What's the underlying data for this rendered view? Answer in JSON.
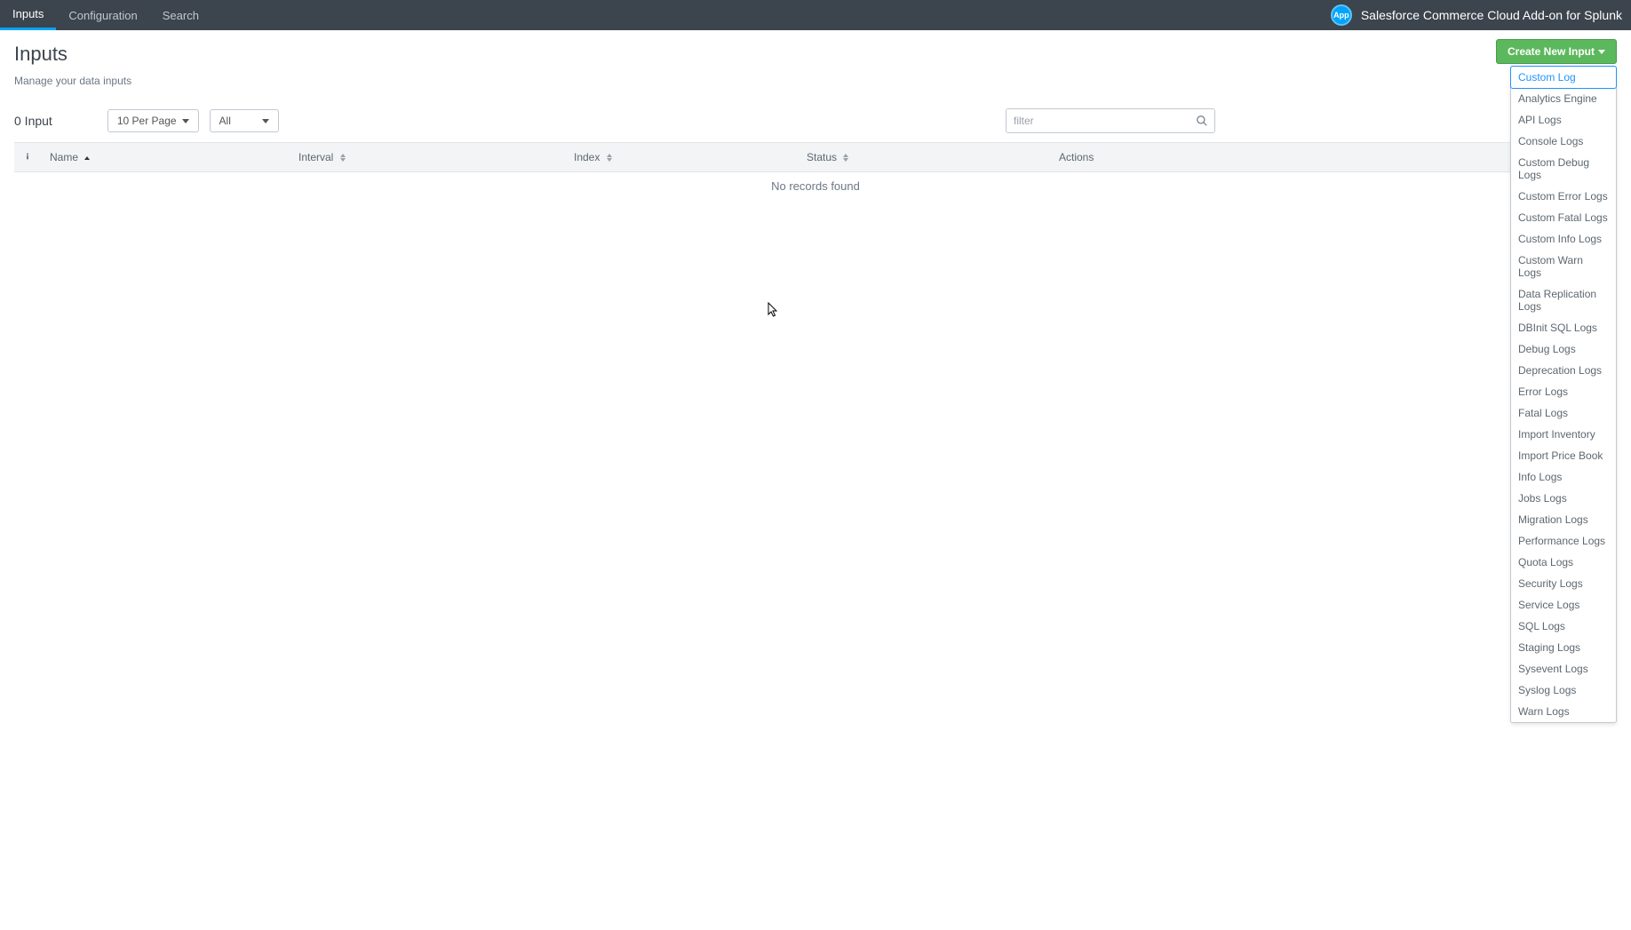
{
  "nav": {
    "tabs": [
      "Inputs",
      "Configuration",
      "Search"
    ],
    "active": 0,
    "app_icon_text": "App",
    "app_title": "Salesforce Commerce Cloud Add-on for Splunk"
  },
  "page": {
    "title": "Inputs",
    "subtitle": "Manage your data inputs",
    "create_btn": "Create New Input"
  },
  "controls": {
    "count": "0 Input",
    "per_page": "10 Per Page",
    "filter_select": "All",
    "filter_placeholder": "filter"
  },
  "table": {
    "cols": {
      "name": "Name",
      "interval": "Interval",
      "index": "Index",
      "status": "Status",
      "actions": "Actions"
    },
    "empty": "No records found"
  },
  "dropdown": [
    "Custom Log",
    "Analytics Engine",
    "API Logs",
    "Console Logs",
    "Custom Debug Logs",
    "Custom Error Logs",
    "Custom Fatal Logs",
    "Custom Info Logs",
    "Custom Warn Logs",
    "Data Replication Logs",
    "DBInit SQL Logs",
    "Debug Logs",
    "Deprecation Logs",
    "Error Logs",
    "Fatal Logs",
    "Import Inventory",
    "Import Price Book",
    "Info Logs",
    "Jobs Logs",
    "Migration Logs",
    "Performance Logs",
    "Quota Logs",
    "Security Logs",
    "Service Logs",
    "SQL Logs",
    "Staging Logs",
    "Sysevent Logs",
    "Syslog Logs",
    "Warn Logs"
  ],
  "dropdown_selected": 0
}
